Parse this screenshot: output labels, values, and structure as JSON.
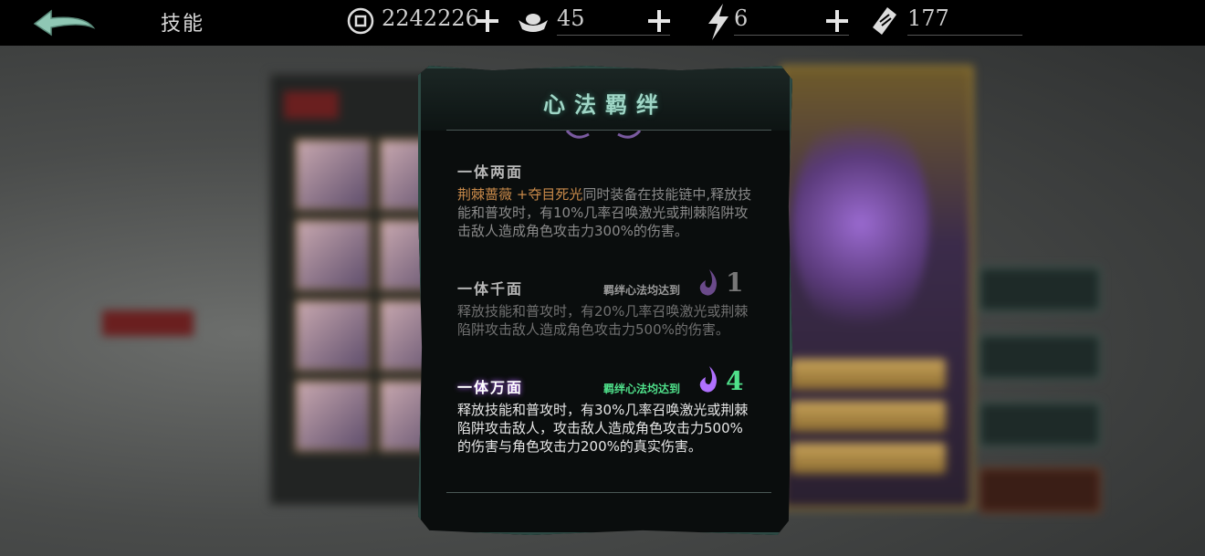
{
  "topbar": {
    "title": "技能",
    "resources": [
      {
        "icon": "copper-coin-icon",
        "value": "2242226"
      },
      {
        "icon": "silver-ingot-icon",
        "value": "45"
      },
      {
        "icon": "lightning-energy-icon",
        "value": "6"
      },
      {
        "icon": "ticket-icon",
        "value": "177"
      }
    ]
  },
  "dialog": {
    "title": "心法羁绊",
    "sections": [
      {
        "title": "一体两面",
        "skill_a": "荆棘蔷薇",
        "plus": " +",
        "skill_b": "夺目死光",
        "body_rest": "同时装备在技能链中,释放技能和普攻时，有10%几率召唤激光或荆棘陷阱攻击敌人造成角色攻击力300%的伤害。"
      },
      {
        "title": "一体千面",
        "req_text": "羁绊心法均达到",
        "req_level": "1",
        "body": "释放技能和普攻时，有20%几率召唤激光或荆棘陷阱攻击敌人造成角色攻击力500%的伤害。"
      },
      {
        "title": "一体万面",
        "req_text": "羁绊心法均达到",
        "req_level": "4",
        "body": "释放技能和普攻时，有30%几率召唤激光或荆棘陷阱攻击敌人，攻击敌人造成角色攻击力500%的伤害与角色攻击力200%的真实伤害。"
      }
    ]
  },
  "colors": {
    "title_teal": "#9fd6c6",
    "skill_highlight": "#c98a4a",
    "req_active": "#4fe08a",
    "frame_border": "#2d4a44"
  }
}
